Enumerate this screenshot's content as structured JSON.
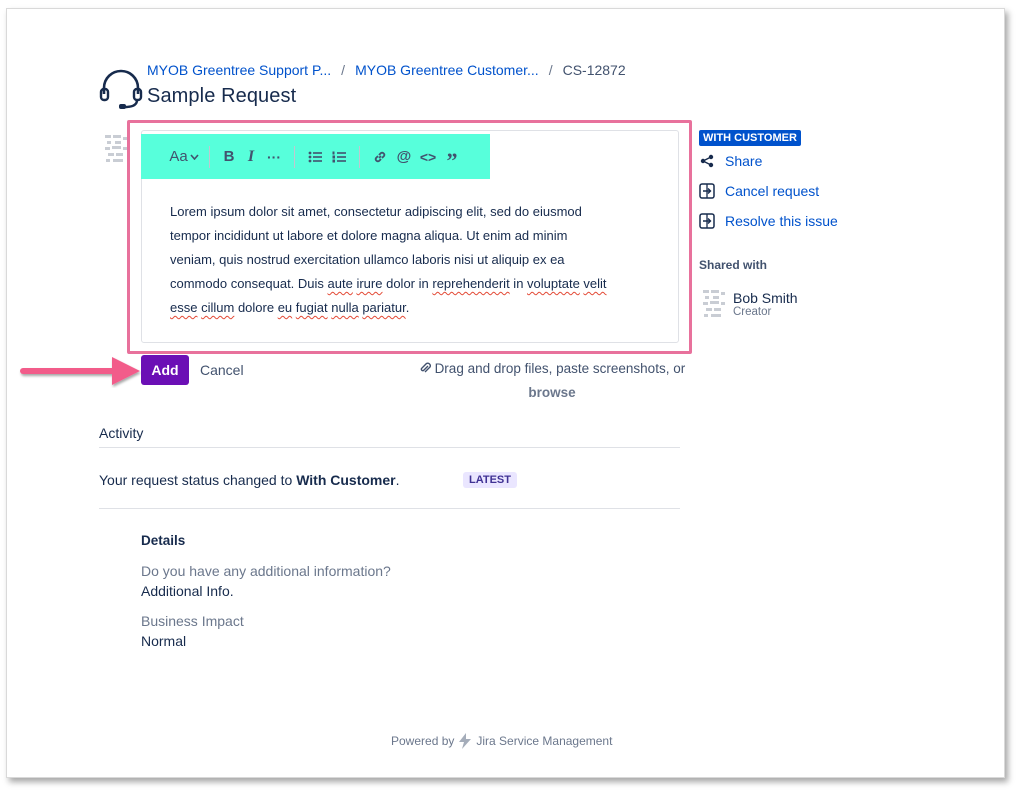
{
  "breadcrumb": {
    "project": "MYOB Greentree Support P...",
    "portal": "MYOB Greentree Customer...",
    "issue_key": "CS-12872"
  },
  "page_title": "Sample Request",
  "toolbar": {
    "text_style_label": "Aa",
    "icons": [
      "text-style-icon",
      "bold-icon",
      "italic-icon",
      "more-icon",
      "bullet-list-icon",
      "numbered-list-icon",
      "link-icon",
      "mention-icon",
      "code-icon",
      "quote-icon"
    ]
  },
  "editor": {
    "line1": "Lorem ipsum dolor sit amet, consectetur adipiscing elit, sed do eiusmod",
    "line2": "tempor incididunt ut labore et dolore magna aliqua. Ut enim ad minim",
    "line3": "veniam, quis nostrud exercitation ullamco laboris nisi ut aliquip ex ea",
    "line4a": "commodo consequat. Duis ",
    "w_aute": "aute",
    "sp1": " ",
    "w_irure": "irure",
    "line4b": " dolor in ",
    "w_reprehenderit": "reprehenderit",
    "line4c": " in ",
    "w_voluptate": "voluptate",
    "sp2": " ",
    "w_velit": "velit",
    "w_esse": "esse",
    "w_cillum": "cillum",
    "line5a": " dolore ",
    "w_eu": "eu",
    "sp3": " ",
    "w_fugiat": "fugiat",
    "sp4": " ",
    "w_nulla": "nulla",
    "sp5": " ",
    "w_pariatur": "pariatur",
    "line5b": "."
  },
  "actions": {
    "add_label": "Add",
    "cancel_label": "Cancel",
    "dropzone_text": "Drag and drop files, paste screenshots, or",
    "browse_label": "browse"
  },
  "activity": {
    "title": "Activity",
    "status_prefix": "Your request status changed to ",
    "status_value": "With Customer",
    "status_suffix": ".",
    "latest_badge": "LATEST"
  },
  "details": {
    "title": "Details",
    "fields": [
      {
        "label": "Do you have any additional information?",
        "value": "Additional Info."
      },
      {
        "label": "Business Impact",
        "value": "Normal"
      }
    ]
  },
  "sidebar": {
    "status": "WITH CUSTOMER",
    "share_label": "Share",
    "cancel_request_label": "Cancel request",
    "resolve_label": "Resolve this issue",
    "shared_with_title": "Shared with",
    "shared_user": {
      "name": "Bob Smith",
      "role": "Creator"
    }
  },
  "footer": {
    "powered_by": "Powered by",
    "product": "Jira Service Management"
  },
  "colors": {
    "toolbar_highlight": "#57ffdb",
    "editor_highlight_border": "#e8719c",
    "add_button": "#6b0fb5",
    "link": "#0052cc",
    "status_pill": "#0052cc",
    "arrow": "#f25c8a"
  }
}
